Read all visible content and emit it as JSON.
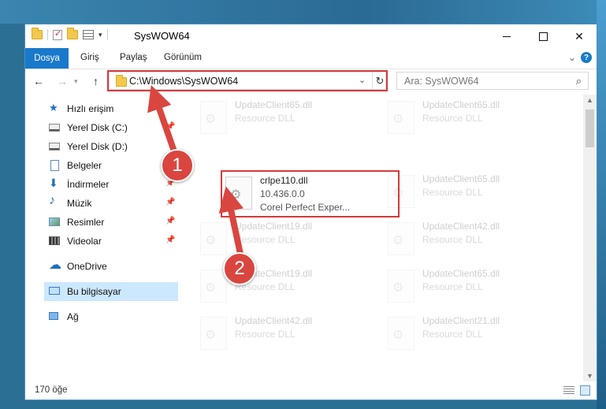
{
  "window": {
    "title": "SysWOW64",
    "qat_dropdown": "▾",
    "controls": {
      "minimize": "",
      "maximize": "",
      "close": "✕"
    }
  },
  "ribbon": {
    "tabs": [
      "Dosya",
      "Giriş",
      "Paylaş",
      "Görünüm"
    ],
    "collapse_glyph": "⌄",
    "help_glyph": "?"
  },
  "nav": {
    "back_glyph": "←",
    "forward_glyph": "→",
    "recent_glyph": "▾",
    "up_glyph": "↑",
    "address": "C:\\Windows\\SysWOW64",
    "address_dropdown_glyph": "⌄",
    "refresh_glyph": "↻",
    "search_placeholder": "Ara: SysWOW64",
    "search_glyph": "⌕"
  },
  "sidebar": {
    "items": [
      {
        "label": "Hızlı erişim",
        "icon": "star-icon",
        "pinned": false
      },
      {
        "label": "Yerel Disk (C:)",
        "icon": "drive-icon",
        "pinned": true
      },
      {
        "label": "Yerel Disk (D:)",
        "icon": "drive-icon",
        "pinned": false
      },
      {
        "label": "Belgeler",
        "icon": "documents-icon",
        "pinned": true
      },
      {
        "label": "İndirmeler",
        "icon": "downloads-icon",
        "pinned": true
      },
      {
        "label": "Müzik",
        "icon": "music-icon",
        "pinned": true
      },
      {
        "label": "Resimler",
        "icon": "pictures-icon",
        "pinned": true
      },
      {
        "label": "Videolar",
        "icon": "videos-icon",
        "pinned": true
      },
      {
        "label": "OneDrive",
        "icon": "cloud-icon",
        "pinned": false
      },
      {
        "label": "Bu bilgisayar",
        "icon": "computer-icon",
        "pinned": false,
        "selected": true
      },
      {
        "label": "Ağ",
        "icon": "network-icon",
        "pinned": false
      }
    ],
    "pin_glyph": "📌"
  },
  "files": [
    {
      "name": "UpdateClient65.dll",
      "version": "",
      "description": "Resource DLL",
      "faded": true
    },
    {
      "name": "UpdateClient65.dll",
      "version": "",
      "description": "Resource DLL",
      "faded": true
    },
    {
      "name": "crlpe110.dll",
      "version": "10.436.0.0",
      "description": "Corel Perfect Exper...",
      "faded": false
    },
    {
      "name": "UpdateClient65.dll",
      "version": "",
      "description": "Resource DLL",
      "faded": true
    },
    {
      "name": "UpdateClient19.dll",
      "version": "",
      "description": "Resource DLL",
      "faded": true
    },
    {
      "name": "UpdateClient42.dll",
      "version": "",
      "description": "Resource DLL",
      "faded": true
    },
    {
      "name": "UpdateClient19.dll",
      "version": "",
      "description": "Resource DLL",
      "faded": true
    },
    {
      "name": "UpdateClient65.dll",
      "version": "",
      "description": "Resource DLL",
      "faded": true
    },
    {
      "name": "UpdateClient42.dll",
      "version": "",
      "description": "Resource DLL",
      "faded": true
    },
    {
      "name": "UpdateClient21.dll",
      "version": "",
      "description": "Resource DLL",
      "faded": true
    }
  ],
  "file_icon": "gear-file-icon",
  "status": {
    "item_count": "170 öğe"
  },
  "scrollbar": {
    "up": "▲",
    "down": "▼"
  },
  "annotations": {
    "step1": "1",
    "step2": "2",
    "color": "#d9463f"
  }
}
